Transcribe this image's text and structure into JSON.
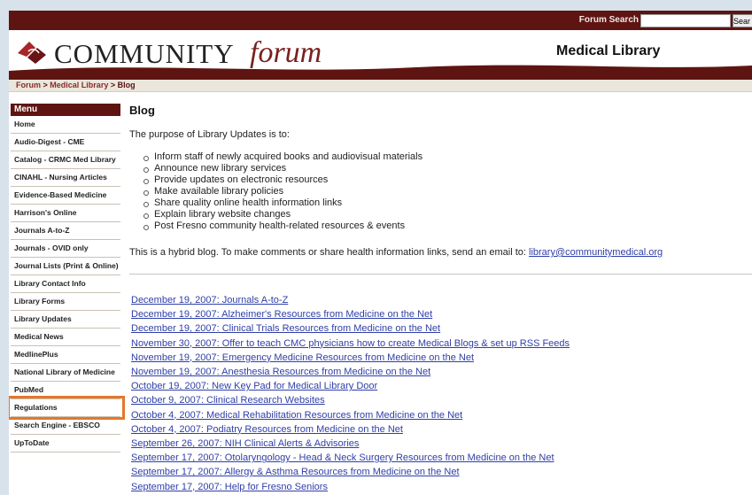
{
  "search": {
    "label": "Forum Search",
    "button_label": "Sear"
  },
  "logo": {
    "word1": "COMMUNITY",
    "word2": "forum"
  },
  "header": {
    "title": "Medical Library"
  },
  "breadcrumb": {
    "items": [
      "Forum",
      "Medical Library",
      "Blog"
    ],
    "separator": ">"
  },
  "sidebar": {
    "menu_title": "Menu",
    "items": [
      "Home",
      "Audio-Digest - CME",
      "Catalog - CRMC Med Library",
      "CINAHL - Nursing Articles",
      "Evidence-Based Medicine",
      "Harrison's Online",
      "Journals A-to-Z",
      "Journals - OVID only",
      "Journal Lists (Print & Online)",
      "Library Contact Info",
      "Library Forms",
      "Library Updates",
      "Medical News",
      "MedlinePlus",
      "National Library of Medicine",
      "PubMed",
      "Regulations",
      "Search Engine - EBSCO",
      "UpToDate"
    ],
    "active_item": "Library Updates"
  },
  "main": {
    "title": "Blog",
    "intro": "The purpose of Library Updates is to:",
    "purposes": [
      "Inform staff of newly acquired books and audiovisual materials",
      "Announce new library services",
      "Provide updates on electronic resources",
      "Make available library policies",
      "Share quality online health information links",
      "Explain library website changes",
      "Post Fresno community health-related resources & events"
    ],
    "hybrid_text": "This is a hybrid blog.  To make comments or share health information links, send an email to: ",
    "email": "library@communitymedical.org",
    "posts": [
      "December 19, 2007: Journals A-to-Z",
      "December 19, 2007: Alzheimer's Resources from Medicine on the Net",
      "December 19, 2007: Clinical Trials Resources from Medicine on the Net",
      "November 30, 2007: Offer to teach CMC physicians how to create Medical Blogs & set up RSS Feeds",
      "November 19, 2007: Emergency Medicine Resources from Medicine on the Net",
      "November 19, 2007: Anesthesia Resources from Medicine on the Net",
      "October 19, 2007: New Key Pad for Medical Library Door",
      "October 9, 2007: Clinical Research Websites",
      "October 4, 2007: Medical Rehabilitation Resources from Medicine on the Net",
      "October 4, 2007: Podiatry Resources from Medicine on the Net",
      "September 26, 2007: NIH Clinical Alerts & Advisories",
      "September 17, 2007: Otolaryngology - Head & Neck Surgery Resources from Medicine on the Net",
      "September 17, 2007: Allergy & Asthma Resources from Medicine on the Net",
      "September 17, 2007: Help for Fresno Seniors"
    ]
  },
  "colors": {
    "brand": "#5e1512",
    "link": "#2f3fa8",
    "highlight": "#e3782a",
    "background": "#d7e2ea"
  }
}
